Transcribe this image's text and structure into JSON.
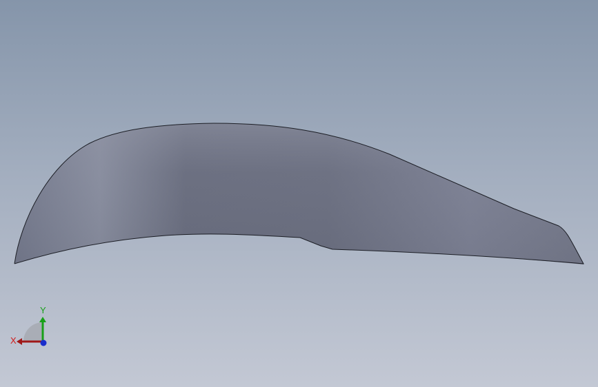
{
  "triad": {
    "x_label": "X",
    "y_label": "Y",
    "x_color": "#a01818",
    "y_color": "#18a018",
    "z_color": "#1a2ecc"
  },
  "model": {
    "surface_color": "#6c7184",
    "highlight_color": "#8a8fa2",
    "edge_color": "#1b1d24"
  }
}
